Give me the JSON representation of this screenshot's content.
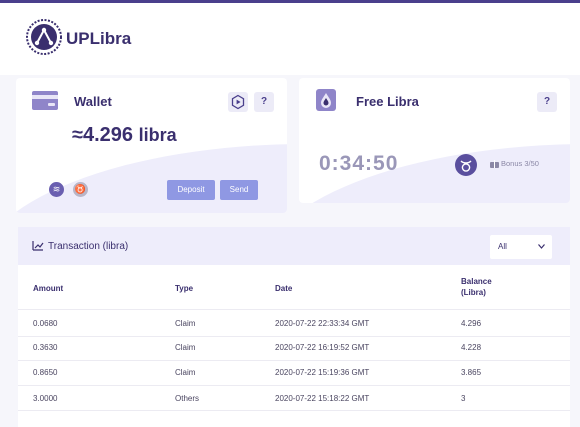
{
  "brand": {
    "name": "UPLibra"
  },
  "wallet": {
    "title": "Wallet",
    "balance_prefix": "≈",
    "balance_value": "4.296",
    "balance_unit": "libra",
    "help_label": "?",
    "deposit_label": "Deposit",
    "send_label": "Send"
  },
  "free": {
    "title": "Free Libra",
    "help_label": "?",
    "timer": "0:34:50",
    "bonus": "Bonus 3/50"
  },
  "transactions": {
    "title": "Transaction (libra)",
    "filter": "All",
    "headers": {
      "amount": "Amount",
      "type": "Type",
      "date": "Date",
      "balance_1": "Balance",
      "balance_2": "(Libra)"
    },
    "rows": [
      {
        "amount": "0.0680",
        "type": "Claim",
        "date": "2020-07-22 22:33:34 GMT",
        "balance": "4.296"
      },
      {
        "amount": "0.3630",
        "type": "Claim",
        "date": "2020-07-22 16:19:52 GMT",
        "balance": "4.228"
      },
      {
        "amount": "0.8650",
        "type": "Claim",
        "date": "2020-07-22 15:19:36 GMT",
        "balance": "3.865"
      },
      {
        "amount": "3.0000",
        "type": "Others",
        "date": "2020-07-22 15:18:22 GMT",
        "balance": "3"
      }
    ]
  },
  "colors": {
    "brand": "#3a2f6e",
    "accent": "#8f98e3",
    "wave": "#eeedfb"
  }
}
